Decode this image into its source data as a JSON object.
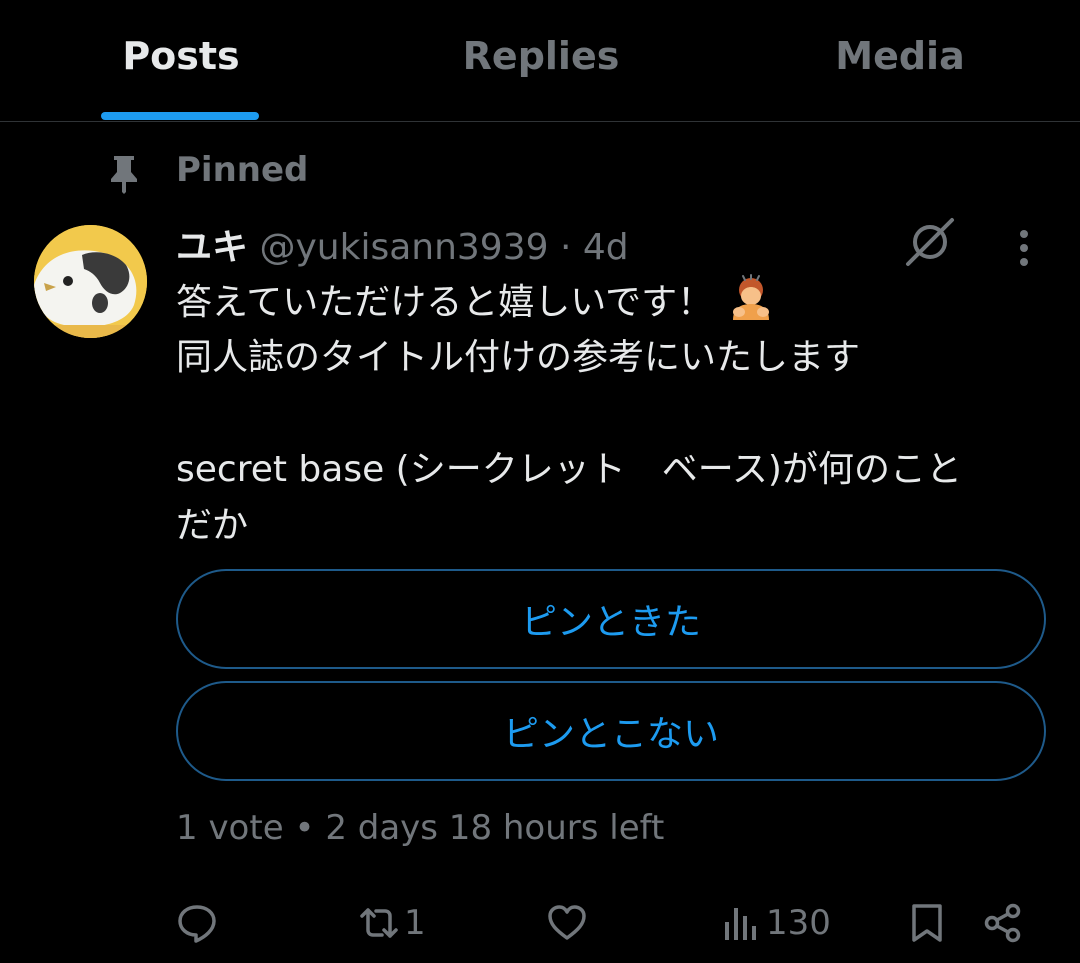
{
  "tabs": [
    {
      "label": "Posts",
      "active": true
    },
    {
      "label": "Replies",
      "active": false
    },
    {
      "label": "Media",
      "active": false
    }
  ],
  "pinned": {
    "label": "Pinned",
    "icon": "pin-icon"
  },
  "post": {
    "author": {
      "display_name": "ユキ",
      "handle": "@yukisann3939",
      "avatar": "avatar-icon"
    },
    "separator": "·",
    "time": "4d",
    "text_lines": [
      "答えていただけると嬉しいです！",
      "同人誌のタイトル付けの参考にいたします",
      "",
      "secret base (シークレット　ベース)が何のこと",
      "だか"
    ],
    "emoji": "person-bowing-emoji",
    "poll": {
      "options": [
        "ピンときた",
        "ピンとこない"
      ],
      "votes": "1 vote",
      "separator": "•",
      "time_left": "2 days 18 hours left"
    },
    "actions": {
      "reply": {
        "icon": "reply-icon",
        "count": ""
      },
      "repost": {
        "icon": "repost-icon",
        "count": "1"
      },
      "like": {
        "icon": "heart-icon",
        "count": ""
      },
      "views": {
        "icon": "views-icon",
        "count": "130"
      },
      "bookmark": {
        "icon": "bookmark-icon"
      },
      "share": {
        "icon": "share-icon"
      }
    }
  },
  "colors": {
    "background": "#000000",
    "accent": "#1d9bf0",
    "text_primary": "#e7e9ea",
    "text_secondary": "#71767b",
    "divider": "#2f3336",
    "poll_border": "#1e5a8a",
    "avatar_bg": "#f2c94c"
  }
}
